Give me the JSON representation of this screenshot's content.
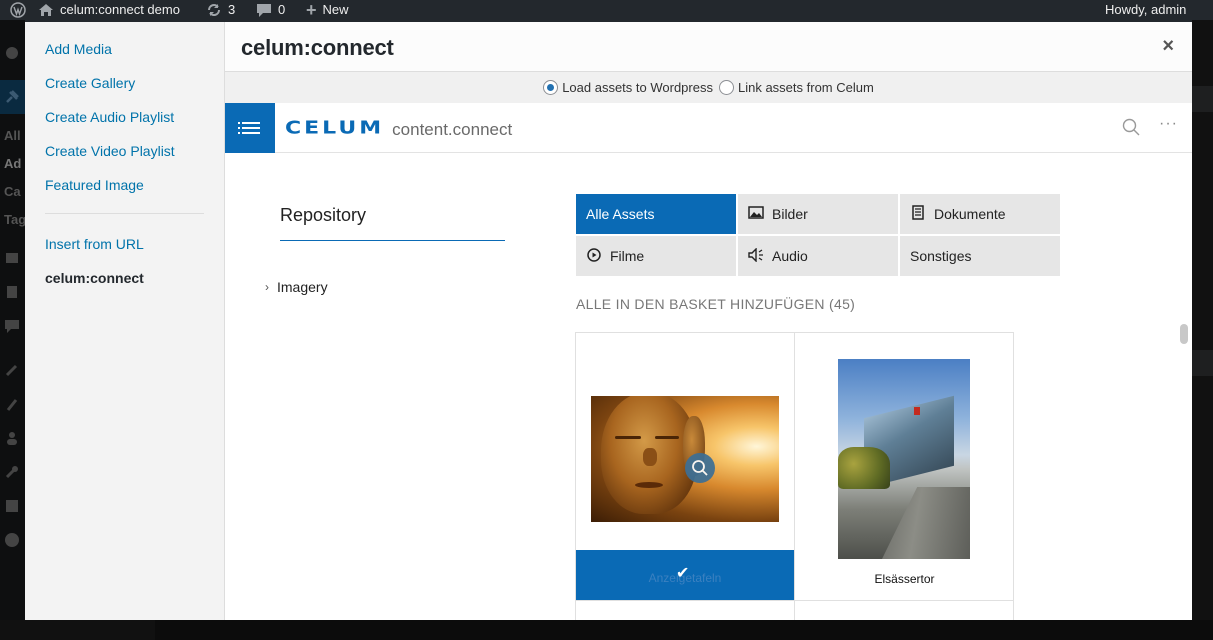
{
  "admin_bar": {
    "site_name": "celum:connect demo",
    "updates_count": "3",
    "comments_count": "0",
    "new_label": "New",
    "greeting": "Howdy, admin"
  },
  "admin_menu_fragments": [
    "All",
    "Ad",
    "Ca",
    "Tag"
  ],
  "media_menu": {
    "items": [
      {
        "label": "Add Media"
      },
      {
        "label": "Create Gallery"
      },
      {
        "label": "Create Audio Playlist"
      },
      {
        "label": "Create Video Playlist"
      },
      {
        "label": "Featured Image"
      },
      {
        "label": "Insert from URL"
      },
      {
        "label": "celum:connect"
      }
    ]
  },
  "modal": {
    "title": "celum:connect",
    "close_symbol": "×"
  },
  "load_options": {
    "selected": "load",
    "load_label": "Load assets to Wordpress",
    "link_label": "Link assets from Celum"
  },
  "celum_header": {
    "logo_text": "CELUM",
    "product": "content.connect",
    "more_symbol": "···",
    "accent": "#0a6ab5"
  },
  "repository": {
    "title": "Repository",
    "tree": [
      {
        "label": "Imagery"
      }
    ]
  },
  "asset_tabs": [
    {
      "label": "Alle Assets",
      "icon": ""
    },
    {
      "label": "Bilder",
      "icon": "image-icon"
    },
    {
      "label": "Dokumente",
      "icon": "document-icon"
    },
    {
      "label": "Filme",
      "icon": "play-circle-icon"
    },
    {
      "label": "Audio",
      "icon": "speaker-icon"
    },
    {
      "label": "Sonstiges",
      "icon": ""
    }
  ],
  "basket_action": "ALLE IN DEN BASKET HINZUFÜGEN (45)",
  "assets": [
    {
      "name": "Anzeigetafeln",
      "selected": true
    },
    {
      "name": "Elsässertor",
      "selected": false
    }
  ]
}
